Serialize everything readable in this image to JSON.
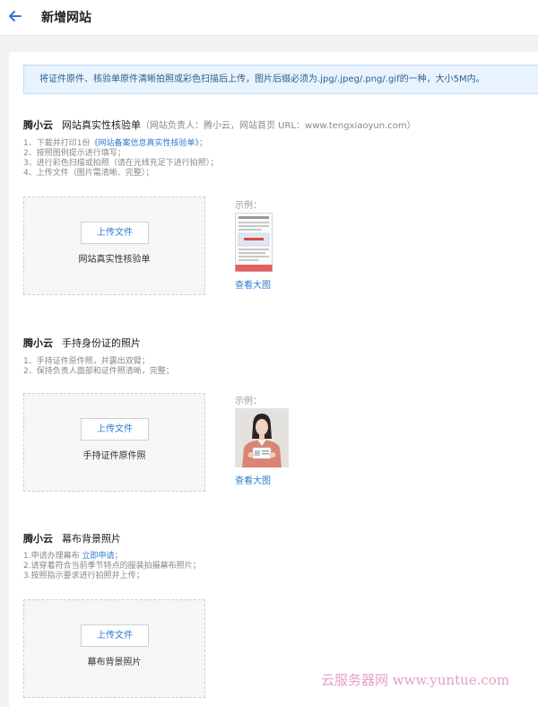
{
  "header": {
    "title": "新增网站"
  },
  "notice": "将证件原件、核验单原件清晰拍照或彩色扫描后上传，图片后缀必须为.jpg/.jpeg/.png/.gif的一种，大小5M内。",
  "sections": [
    {
      "brand": "腾小云",
      "title": "网站真实性核验单",
      "note": "（网站负责人：腾小云，网站首页 URL：www.tengxiaoyun.com）",
      "steps": {
        "s1_pre": "1、下载并打印1份",
        "s1_link": "《网站备案信息真实性核验单》",
        "s1_post": "；",
        "s2": "2、按照图例提示进行填写；",
        "s3": "3、进行彩色扫描或拍照（请在光线充足下进行拍照）；",
        "s4": "4、上传文件（图片需清晰、完整）；"
      },
      "upload_button": "上传文件",
      "upload_label": "网站真实性核验单",
      "example_label": "示例：",
      "view_link": "查看大图"
    },
    {
      "brand": "腾小云",
      "title": "手持身份证的照片",
      "steps": {
        "s1": "1、手持证件原件照，并露出双臂；",
        "s2": "2、保持负责人面部和证件照清晰，完整；"
      },
      "upload_button": "上传文件",
      "upload_label": "手持证件原件照",
      "example_label": "示例：",
      "view_link": "查看大图"
    },
    {
      "brand": "腾小云",
      "title": "幕布背景照片",
      "steps": {
        "s1_pre": "1.申请办理幕布 ",
        "s1_link": "立即申请",
        "s1_post": "；",
        "s2": "2.请穿着符合当前季节特点的服装拍摄幕布照片；",
        "s3": "3.按照指示要求进行拍照并上传；"
      },
      "upload_button": "上传文件",
      "upload_label": "幕布背景照片"
    }
  ],
  "watermark": "云服务器网 www.yuntue.com",
  "colors": {
    "accent": "#2f7bd1",
    "notice_bg": "#e8f3fe",
    "notice_border": "#bfdcf7"
  },
  "icons": {
    "back": "arrow-left-icon"
  }
}
